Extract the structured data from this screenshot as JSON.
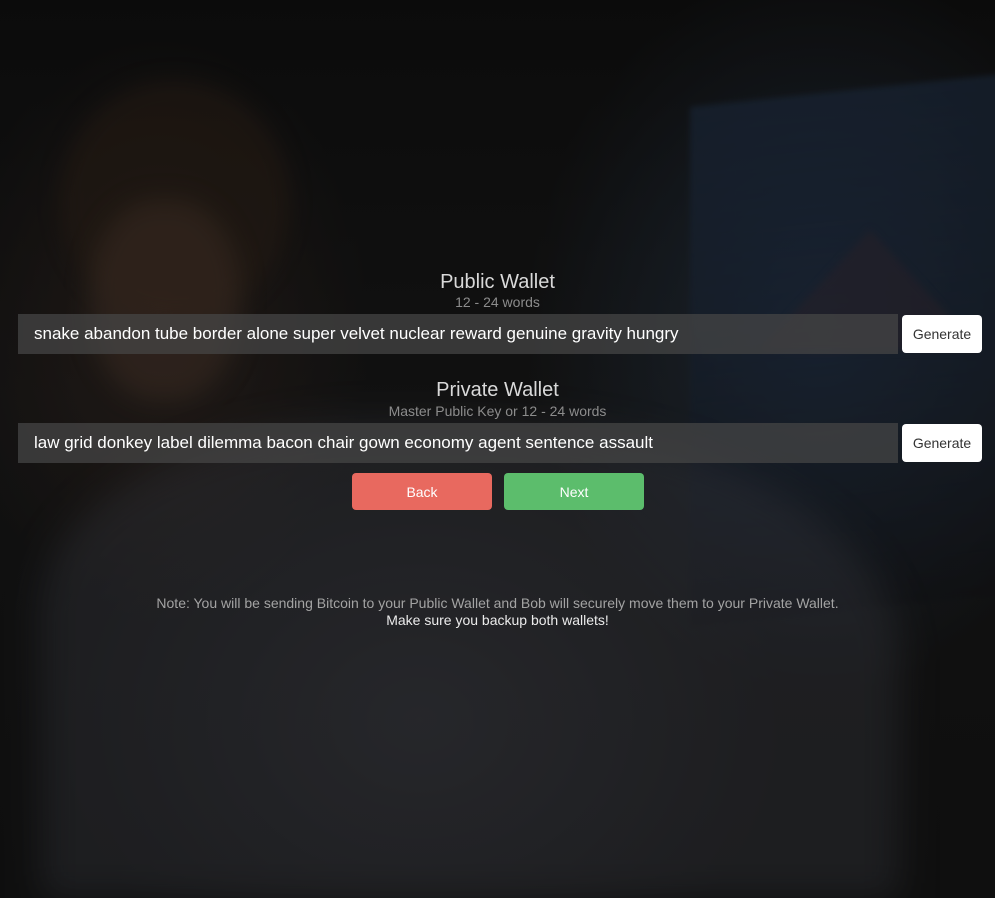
{
  "public_wallet": {
    "title": "Public Wallet",
    "subtitle": "12 - 24 words",
    "value": "snake abandon tube border alone super velvet nuclear reward genuine gravity hungry",
    "generate_label": "Generate"
  },
  "private_wallet": {
    "title": "Private Wallet",
    "subtitle": "Master Public Key or 12 - 24 words",
    "value": "law grid donkey label dilemma bacon chair gown economy agent sentence assault",
    "generate_label": "Generate"
  },
  "nav": {
    "back_label": "Back",
    "next_label": "Next",
    "back_color": "#e8695f",
    "next_color": "#5cbd6c"
  },
  "note": {
    "line1": "Note: You will be sending Bitcoin to your Public Wallet and Bob will securely move them to your Private Wallet.",
    "line2": "Make sure you backup both wallets!"
  }
}
